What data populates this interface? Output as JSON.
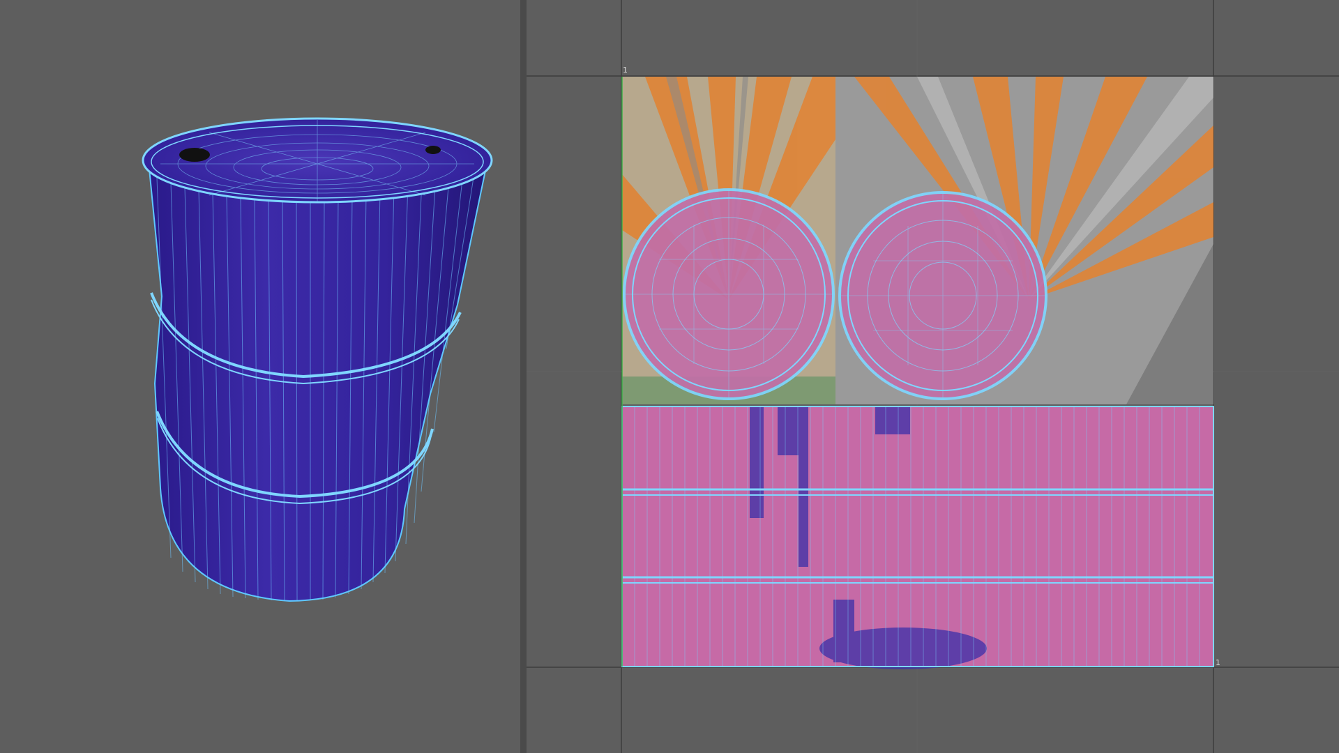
{
  "viewport3d": {
    "object": "oil-barrel",
    "wireframe_color": "#5ec8ff",
    "shade_color": "#3a26a6"
  },
  "uv_editor": {
    "udim_tick_top_left": "1",
    "udim_tick_bottom_right": "1",
    "texture_accent_orange": "#e08436",
    "texture_pink": "#c66aa6",
    "uv_wire_color": "#78d4ff"
  }
}
